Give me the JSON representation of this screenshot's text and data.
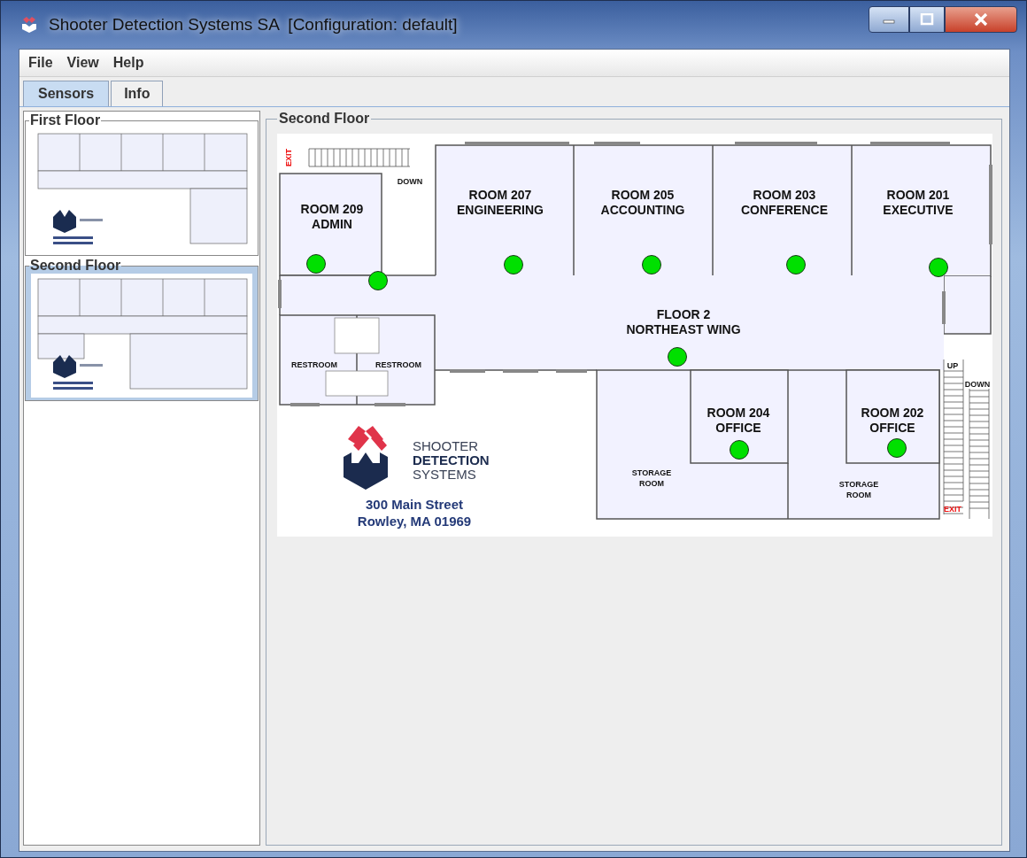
{
  "window": {
    "title": "Shooter Detection Systems SA  [Configuration: default]"
  },
  "menu": [
    "File",
    "View",
    "Help"
  ],
  "tabs": [
    {
      "label": "Sensors",
      "selected": true
    },
    {
      "label": "Info",
      "selected": false
    }
  ],
  "floors": [
    {
      "title": "First Floor",
      "selected": false
    },
    {
      "title": "Second Floor",
      "selected": true
    }
  ],
  "plan": {
    "title": "Second Floor",
    "labels": [
      {
        "kind": "exit",
        "lines": [
          "EXIT"
        ]
      },
      {
        "kind": "small",
        "lines": [
          "DOWN"
        ]
      },
      {
        "kind": "room",
        "lines": [
          "ROOM 209",
          "ADMIN"
        ]
      },
      {
        "kind": "room",
        "lines": [
          "ROOM 207",
          "ENGINEERING"
        ]
      },
      {
        "kind": "room",
        "lines": [
          "ROOM 205",
          "ACCOUNTING"
        ]
      },
      {
        "kind": "room",
        "lines": [
          "ROOM 203",
          "CONFERENCE"
        ]
      },
      {
        "kind": "room",
        "lines": [
          "ROOM 201",
          "EXECUTIVE"
        ]
      },
      {
        "kind": "room",
        "lines": [
          "FLOOR 2",
          "NORTHEAST WING"
        ]
      },
      {
        "kind": "small",
        "lines": [
          "RESTROOM"
        ]
      },
      {
        "kind": "small",
        "lines": [
          "RESTROOM"
        ]
      },
      {
        "kind": "room",
        "lines": [
          "ROOM 204",
          "OFFICE"
        ]
      },
      {
        "kind": "room",
        "lines": [
          "ROOM 202",
          "OFFICE"
        ]
      },
      {
        "kind": "small",
        "lines": [
          "STORAGE",
          "ROOM"
        ]
      },
      {
        "kind": "small",
        "lines": [
          "STORAGE",
          "ROOM"
        ]
      },
      {
        "kind": "small",
        "lines": [
          "UP"
        ]
      },
      {
        "kind": "small",
        "lines": [
          "DOWN"
        ]
      },
      {
        "kind": "exit",
        "lines": [
          "EXIT"
        ]
      }
    ],
    "sensors": [
      {
        "color": "#00e000"
      },
      {
        "color": "#00e000"
      },
      {
        "color": "#00e000"
      },
      {
        "color": "#00e000"
      },
      {
        "color": "#00e000"
      },
      {
        "color": "#00e000"
      },
      {
        "color": "#00e000"
      },
      {
        "color": "#00e000"
      },
      {
        "color": "#00e000"
      }
    ],
    "logo": {
      "lines": [
        "SHOOTER",
        "DETECTION",
        "SYSTEMS"
      ]
    },
    "address": [
      "300 Main Street",
      "Rowley, MA 01969"
    ]
  }
}
